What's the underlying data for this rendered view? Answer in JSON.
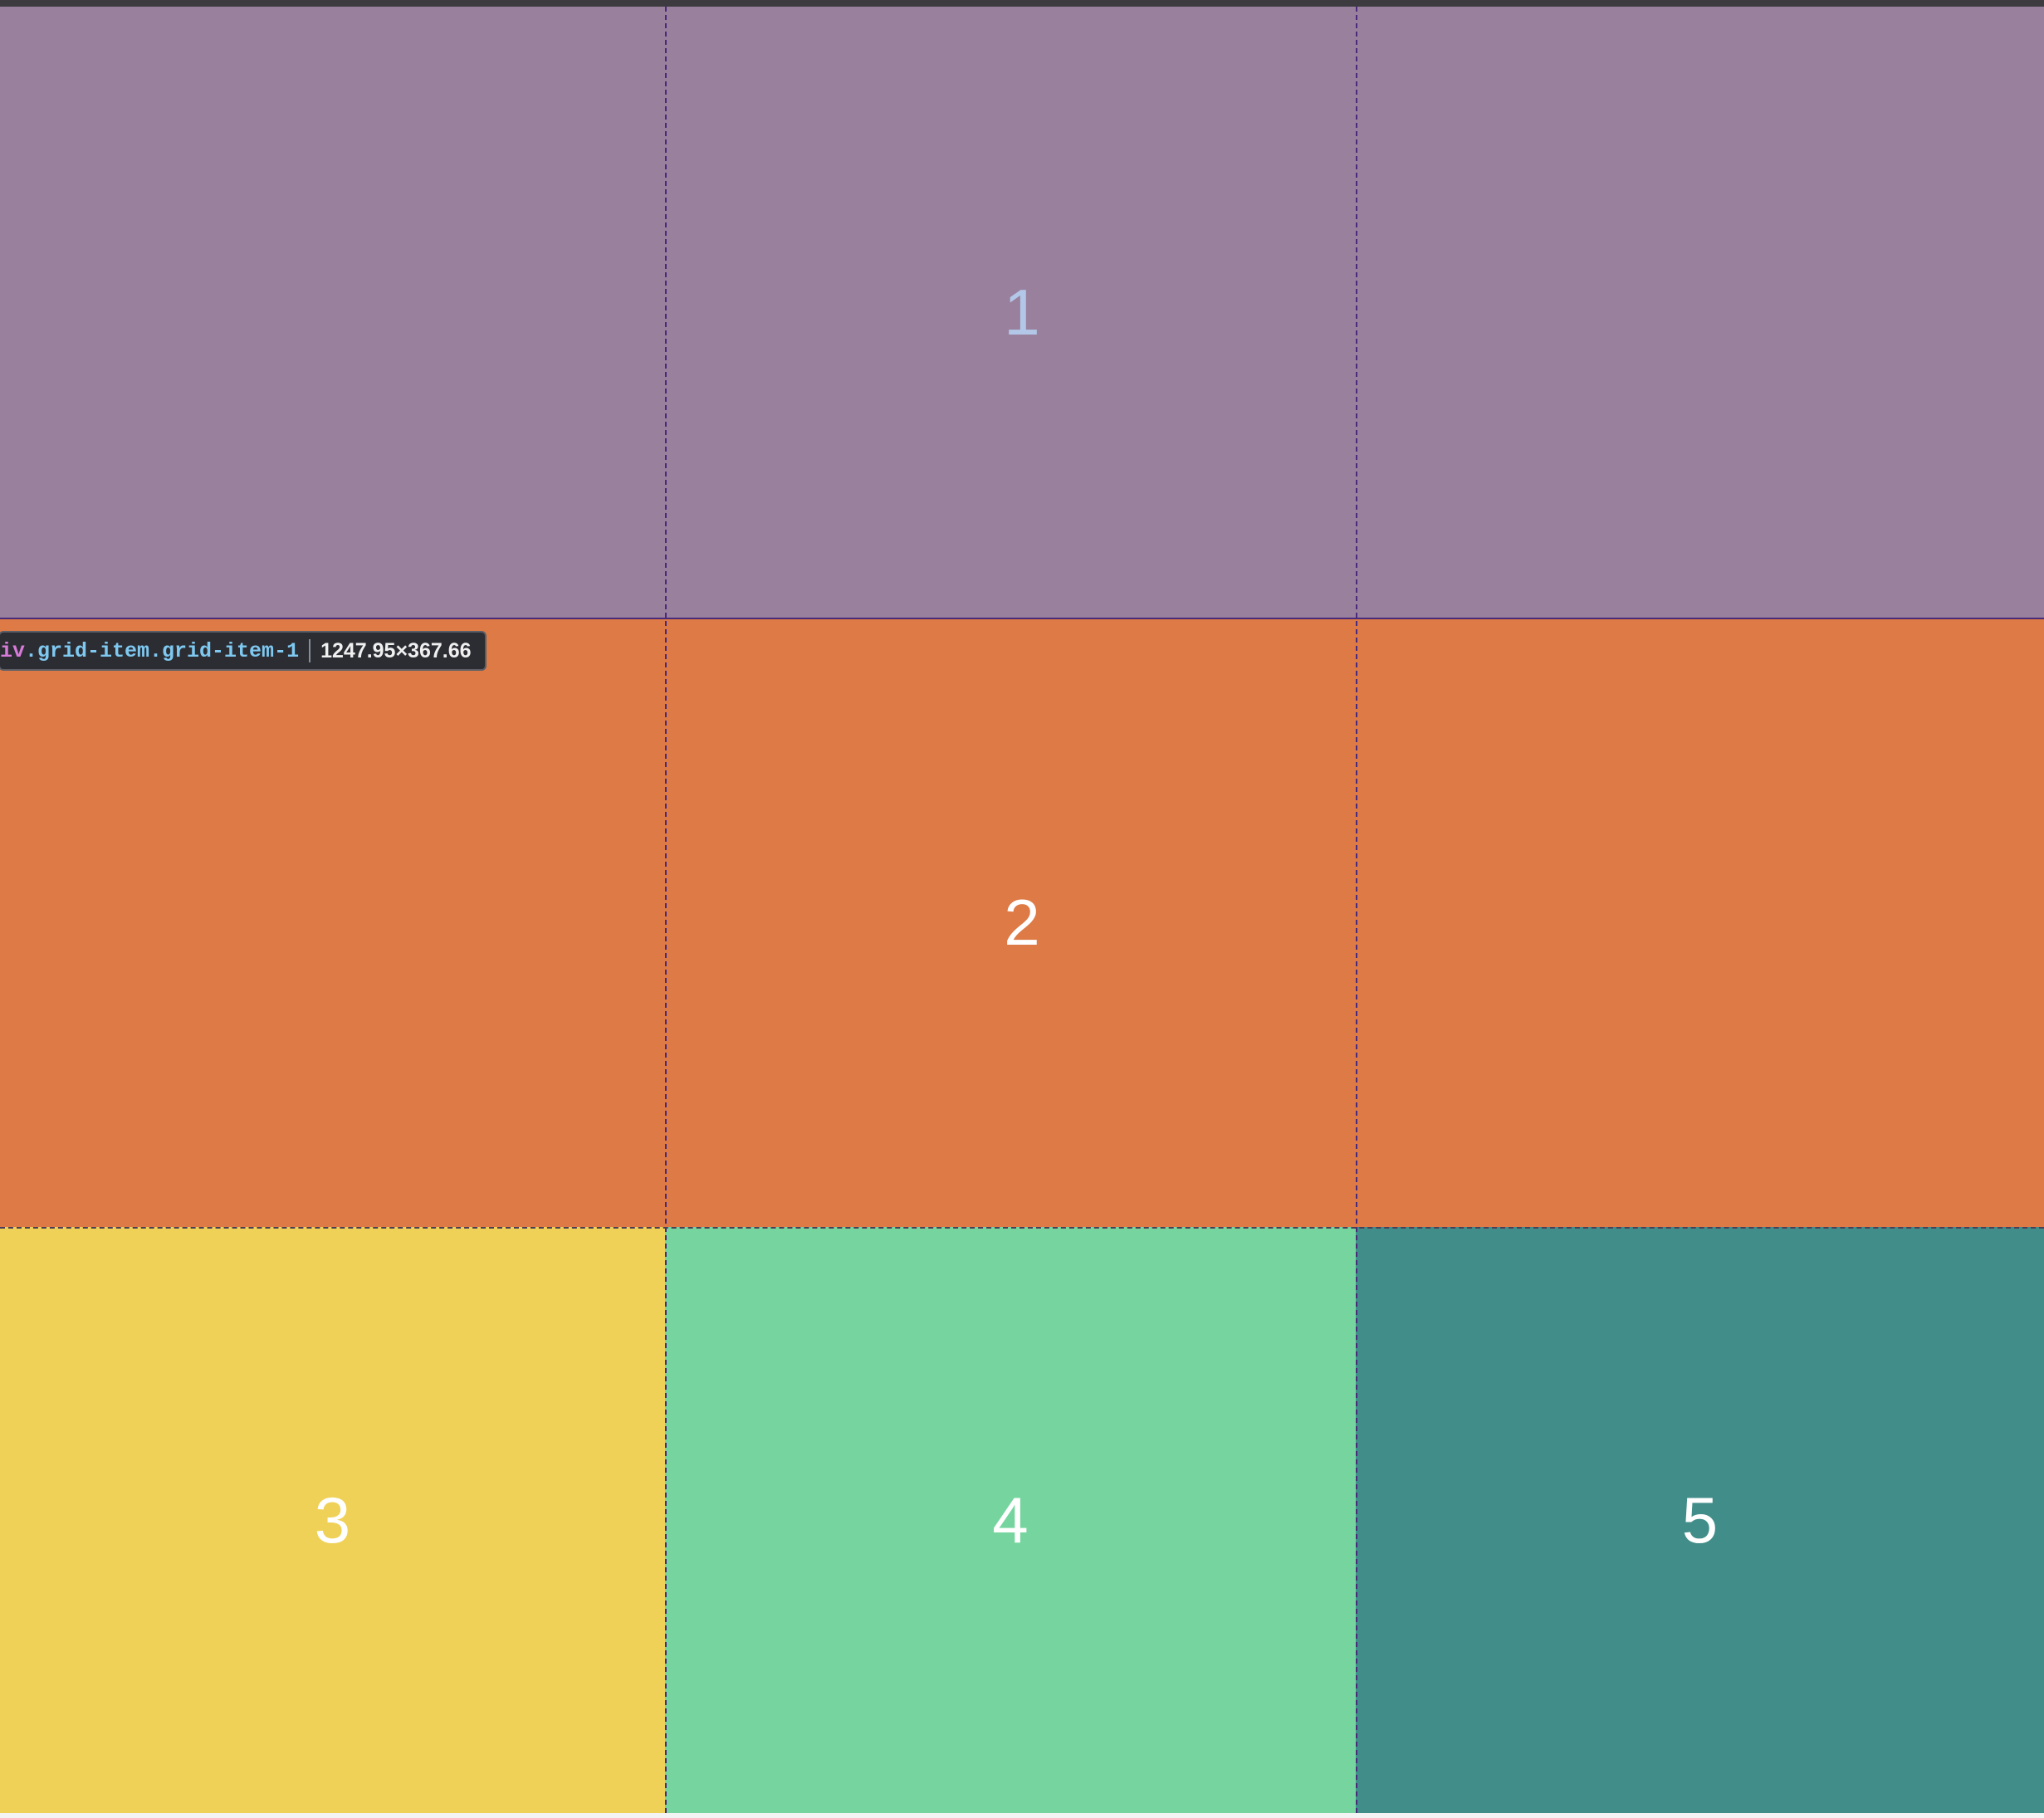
{
  "grid": {
    "items": [
      {
        "label": "1",
        "color": "#99819d"
      },
      {
        "label": "2",
        "color": "#dd7a45"
      },
      {
        "label": "3",
        "color": "#f0d157"
      },
      {
        "label": "4",
        "color": "#76d59f"
      },
      {
        "label": "5",
        "color": "#408d89"
      }
    ]
  },
  "inspector": {
    "tag": "iv",
    "classes": ".grid-item.grid-item-1",
    "dimensions": "1247.95×367.66"
  }
}
